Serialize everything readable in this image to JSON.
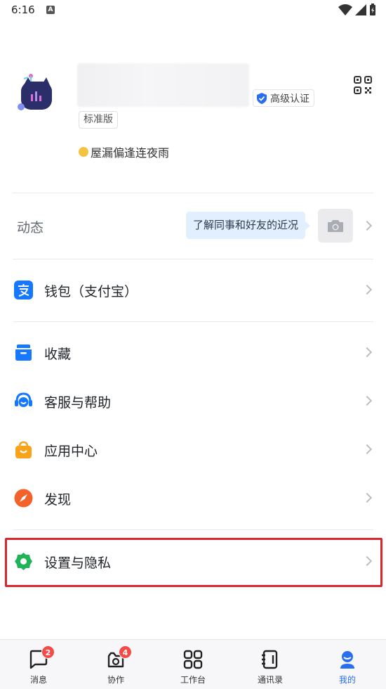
{
  "status_bar": {
    "time": "6:16",
    "app_icon_letter": "A"
  },
  "profile": {
    "auth_badge": "高级认证",
    "edition": "标准版",
    "signature": "屋漏偏逢连夜雨"
  },
  "moments": {
    "label": "动态",
    "hint": "了解同事和好友的近况"
  },
  "menu": {
    "wallet": "钱包（支付宝）",
    "favorites": "收藏",
    "support": "客服与帮助",
    "app_center": "应用中心",
    "discover": "发现",
    "settings": "设置与隐私"
  },
  "bottom_nav": [
    {
      "label": "消息",
      "badge": "2"
    },
    {
      "label": "协作",
      "badge": "4"
    },
    {
      "label": "工作台"
    },
    {
      "label": "通讯录"
    },
    {
      "label": "我的",
      "active": true
    }
  ],
  "colors": {
    "accent": "#2a6ef0",
    "highlight_border": "#d9272e",
    "badge_red": "#f54a45",
    "settings_green": "#1fb35a",
    "discover_orange": "#f4622c",
    "app_center_orange": "#f8a31a"
  }
}
